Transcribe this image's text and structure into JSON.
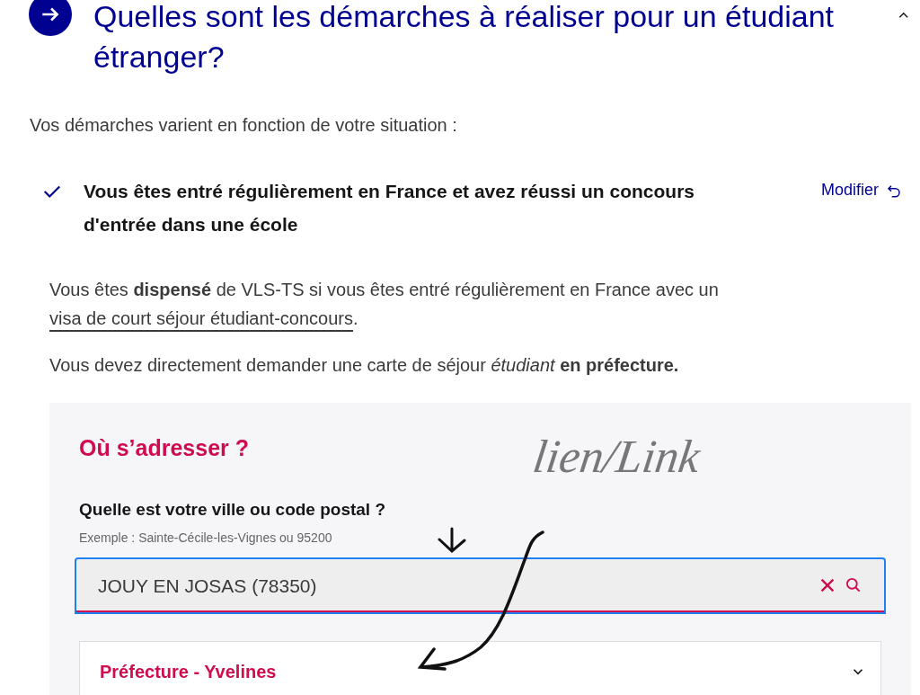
{
  "section": {
    "title": "Quelles sont les démarches à réaliser pour un étudiant étranger?",
    "expanded": true
  },
  "intro": "Vos démarches varient en fonction de votre situation :",
  "choice": {
    "label": "Vous êtes entré régulièrement en France et avez réussi un concours d'entrée dans une école",
    "checked": true,
    "action": "Modifier"
  },
  "paragraphs": [
    {
      "text": "Vous êtes **dispensé** de VLS-TS si vous êtes entré régulièrement en France avec un ",
      "link": "visa de court séjour étudiant-concours",
      "after": "."
    },
    {
      "text": "Vous devez directement demander une carte de séjour *étudiant* **en préfecture.**"
    }
  ],
  "locator": {
    "title": "Où s’adresser ?",
    "label": "Quelle est votre ville ou code postal ?",
    "hint": "Exemple : Sainte-Cécile-les-Vignes ou 95200",
    "value": "JOUY EN JOSAS (78350)",
    "focused": true,
    "results": [
      {
        "name": "Préfecture - Yvelines",
        "expanded": false
      }
    ]
  },
  "annotation": {
    "text": "lien/Link"
  }
}
